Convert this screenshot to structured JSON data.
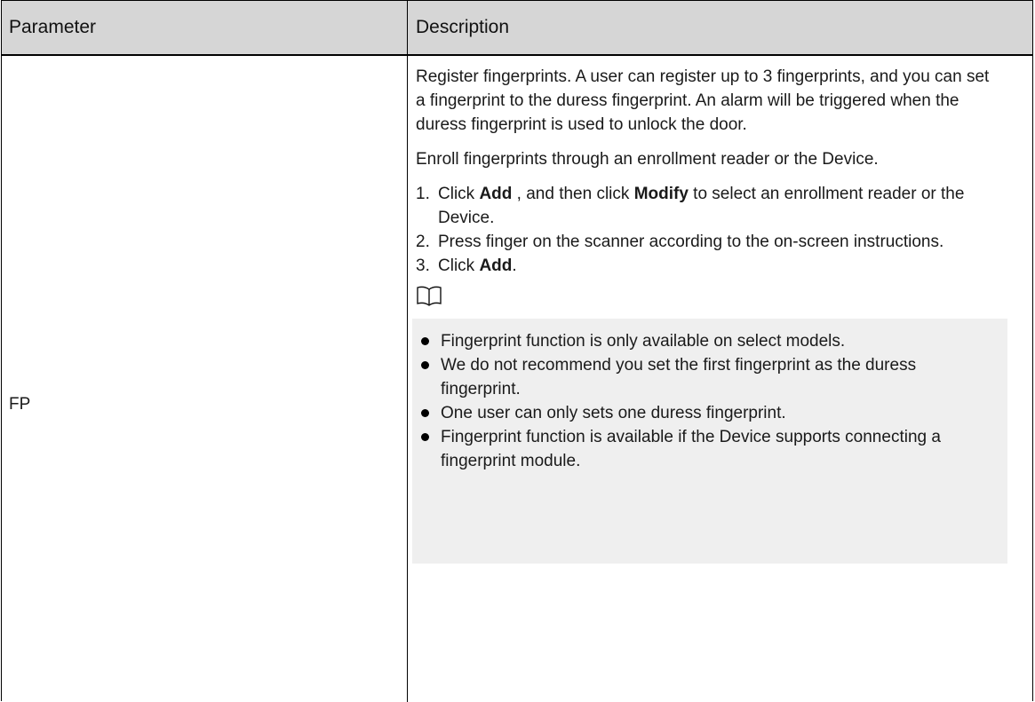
{
  "table": {
    "header": {
      "parameter": "Parameter",
      "description": "Description"
    },
    "row": {
      "parameter": "FP",
      "intro": "Register fingerprints. A user can register up to 3 fingerprints, and you can set a fingerprint to the duress fingerprint. An alarm will be triggered when the duress fingerprint is used to unlock the door.",
      "enroll": "Enroll fingerprints through an enrollment reader or the Device.",
      "steps": [
        {
          "num": "1.",
          "pre": "Click ",
          "bold": "Add",
          "mid": " , and then click ",
          "bold2": "Modify",
          "post": " to select an enrollment reader or the Device."
        },
        {
          "num": "2.",
          "text": "Press finger on the scanner according to the on-screen instructions."
        },
        {
          "num": "3.",
          "pre": "Click ",
          "bold": "Add",
          "post": "."
        }
      ],
      "note_icon": "book-icon",
      "notes": [
        "Fingerprint function is only available on select models.",
        "We do not recommend you set the first fingerprint as the duress fingerprint.",
        "One user can only sets one duress fingerprint.",
        "Fingerprint function is available if the Device supports connecting a fingerprint module."
      ]
    }
  }
}
